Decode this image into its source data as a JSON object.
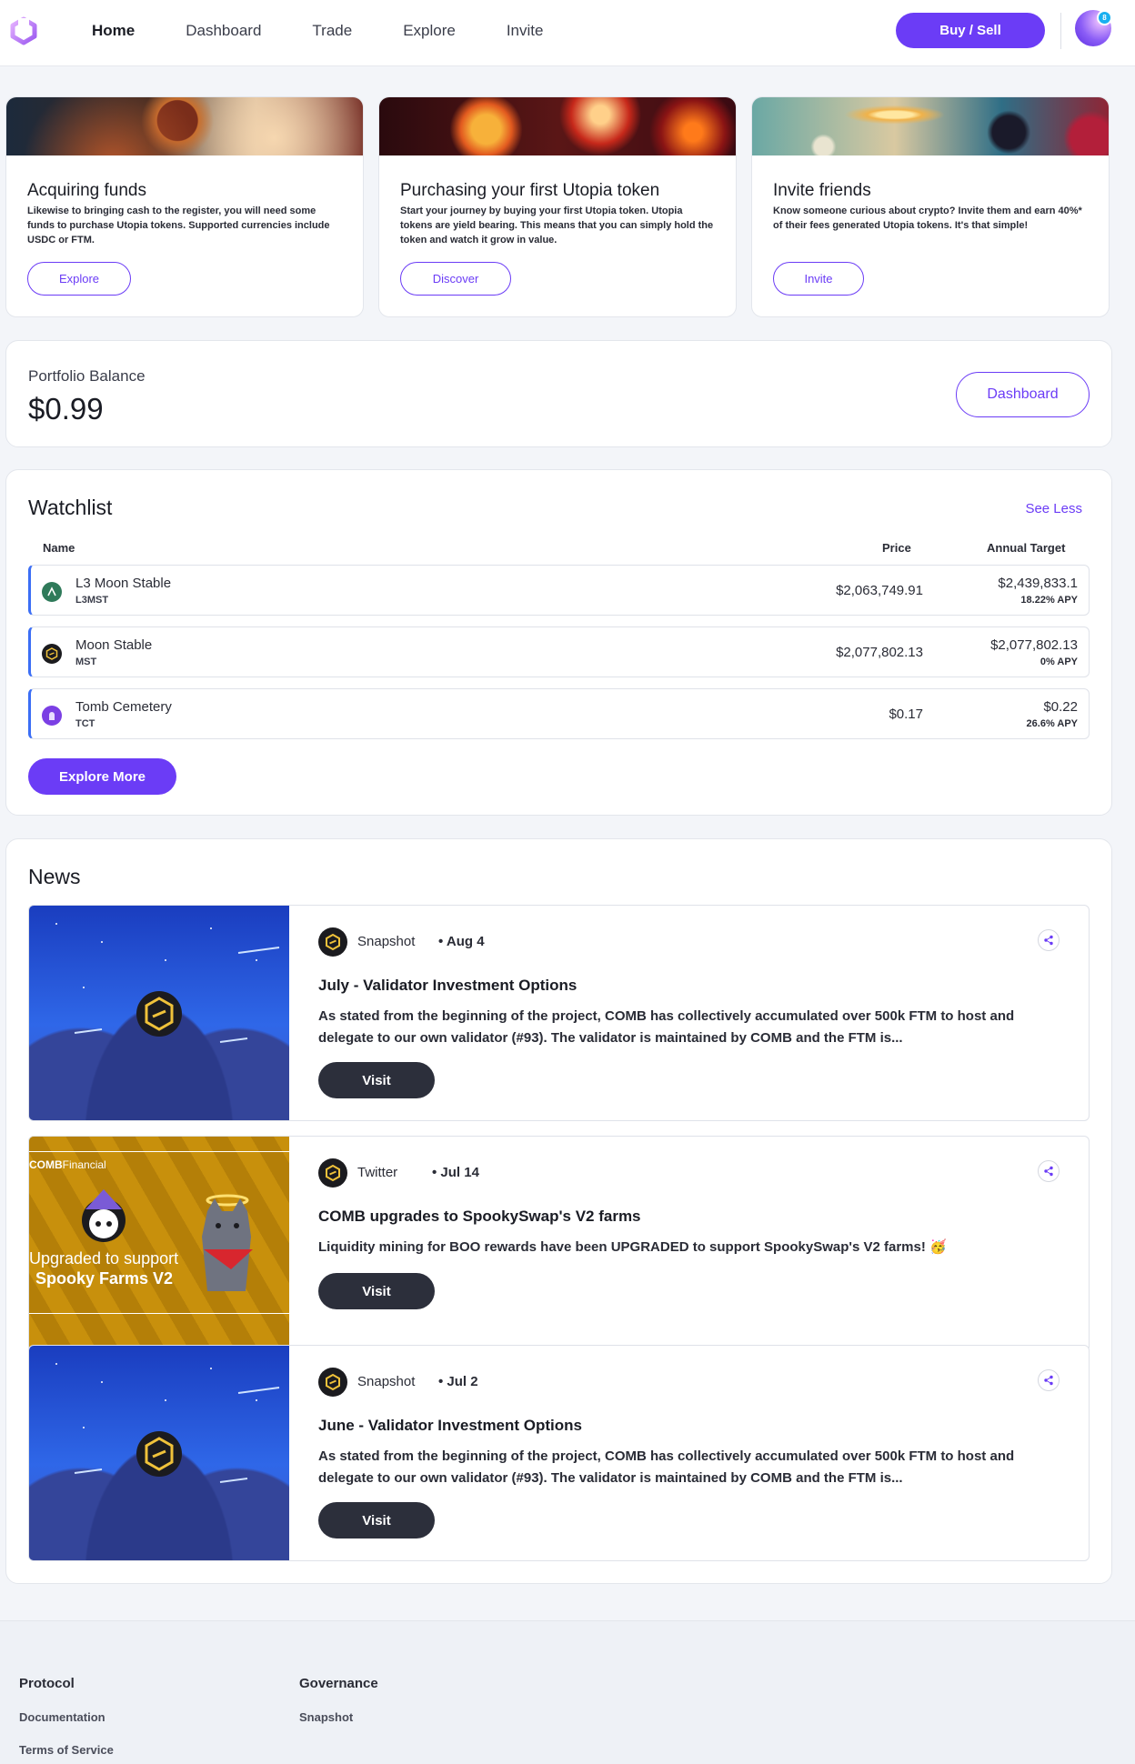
{
  "nav": {
    "items": [
      {
        "label": "Home",
        "active": true
      },
      {
        "label": "Dashboard"
      },
      {
        "label": "Trade"
      },
      {
        "label": "Explore"
      },
      {
        "label": "Invite"
      }
    ],
    "buy_sell_label": "Buy / Sell",
    "avatar_badge": "8"
  },
  "features": [
    {
      "title": "Acquiring funds",
      "body": "Likewise to bringing cash to the register, you will need some funds to purchase Utopia tokens. Supported currencies include USDC or FTM.",
      "button": "Explore"
    },
    {
      "title": "Purchasing your first Utopia token",
      "body": "Start your journey by buying your first Utopia token. Utopia tokens are yield bearing. This means that you can simply hold the token and watch it grow in value.",
      "button": "Discover"
    },
    {
      "title": "Invite friends",
      "body": "Know someone curious about crypto? Invite them and earn 40%* of their fees generated Utopia tokens. It's that simple!",
      "button": "Invite"
    }
  ],
  "portfolio": {
    "label": "Portfolio Balance",
    "value": "$0.99",
    "button": "Dashboard"
  },
  "watchlist": {
    "title": "Watchlist",
    "see_less": "See Less",
    "columns": {
      "name": "Name",
      "price": "Price",
      "target": "Annual Target"
    },
    "rows": [
      {
        "name": "L3 Moon Stable",
        "symbol": "L3MST",
        "price": "$2,063,749.91",
        "target": "$2,439,833.1",
        "apy": "18.22% APY",
        "icon": "l3-icon"
      },
      {
        "name": "Moon Stable",
        "symbol": "MST",
        "price": "$2,077,802.13",
        "target": "$2,077,802.13",
        "apy": "0% APY",
        "icon": "mst-icon"
      },
      {
        "name": "Tomb Cemetery",
        "symbol": "TCT",
        "price": "$0.17",
        "target": "$0.22",
        "apy": "26.6% APY",
        "icon": "tomb-icon"
      }
    ],
    "explore_more": "Explore More"
  },
  "news": {
    "title": "News",
    "items": [
      {
        "source": "Snapshot",
        "date": "• Aug 4",
        "headline": "July - Validator Investment Options",
        "body": "As stated from the beginning of the project, COMB has collectively accumulated over 500k FTM to host and delegate to our own validator (#93). The validator is maintained by COMB and the FTM is...",
        "button": "Visit"
      },
      {
        "source": "Twitter",
        "date": "• Jul 14",
        "headline": "COMB upgrades to SpookySwap's V2 farms",
        "body": "Liquidity mining for BOO rewards have been UPGRADED to support SpookySwap's V2 farms! 🥳",
        "button": "Visit",
        "image_text": {
          "brand": "COMB",
          "brand_suffix": "Financial",
          "line1": "Upgraded to support",
          "line2": "Spooky Farms V2"
        }
      },
      {
        "source": "Snapshot",
        "date": "• Jul 2",
        "headline": "June - Validator Investment Options",
        "body": "As stated from the beginning of the project, COMB has collectively accumulated over 500k FTM to host and delegate to our own validator (#93). The validator is maintained by COMB and the FTM is...",
        "button": "Visit"
      }
    ]
  },
  "footer": {
    "col1": {
      "title": "Protocol",
      "links": [
        "Documentation",
        "Terms of Service"
      ]
    },
    "col2": {
      "title": "Governance",
      "links": [
        "Snapshot"
      ]
    }
  },
  "colors": {
    "accent": "#6b3cf6",
    "dark_button": "#2c2f3b",
    "row_accent": "#3b6ef5"
  }
}
